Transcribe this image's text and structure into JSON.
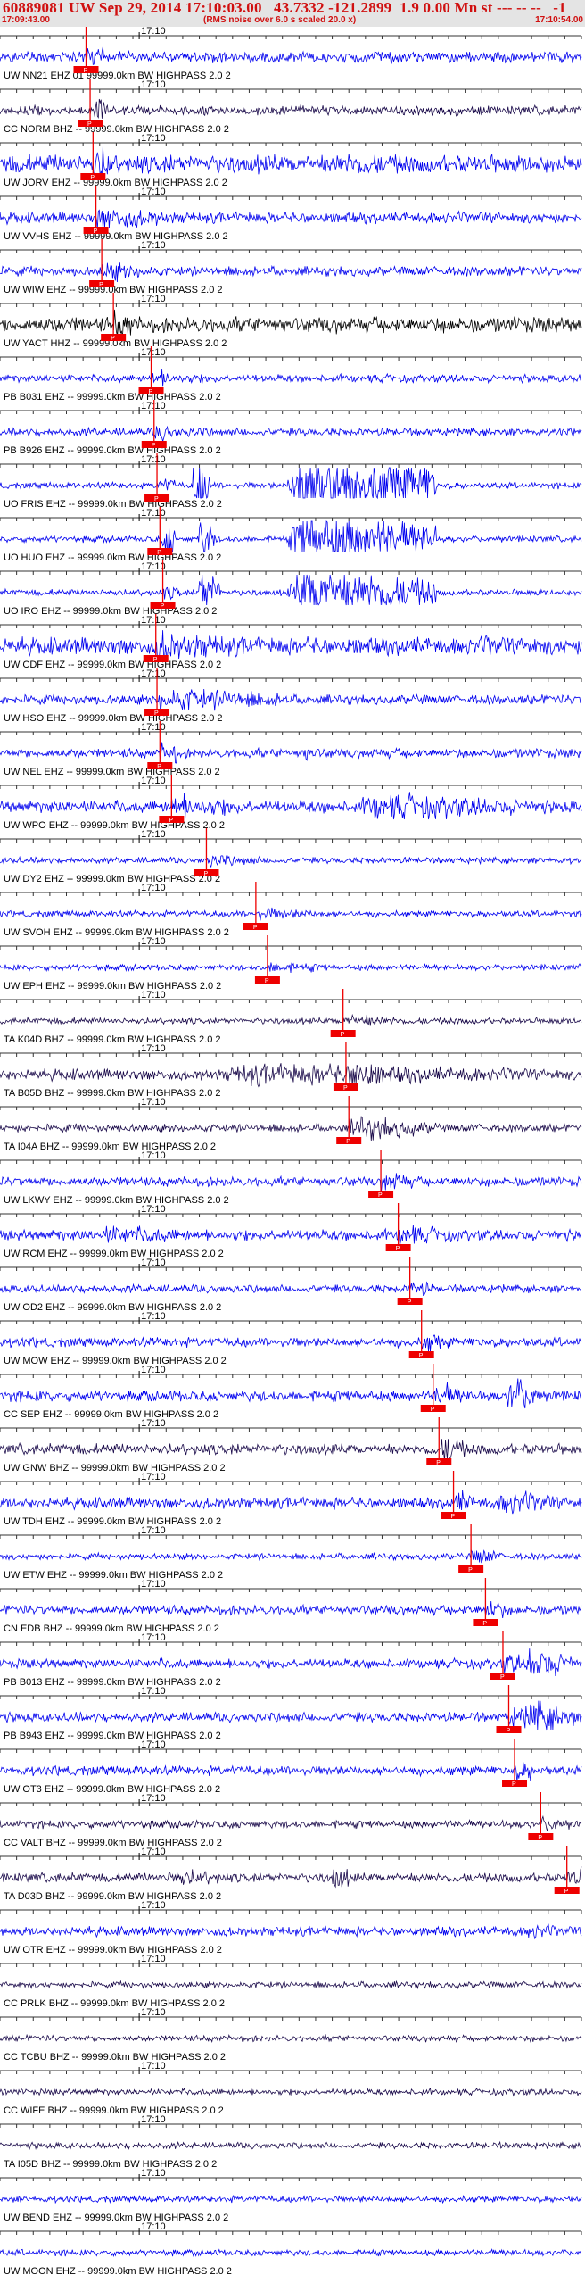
{
  "header": {
    "title": "60889081 UW Sep 29, 2014 17:10:03.00   43.7332 -121.2899  1.9 0.00 Mn st --- -- --   -1",
    "time_start": "17:09:43.00",
    "rms_note": "(RMS noise over 6.0 s scaled 20.0 x)",
    "time_end": "17:10:54.00"
  },
  "chart_data": {
    "type": "line",
    "time_start": "17:09:43.00",
    "time_end": "17:10:54.00",
    "tick_label": "17:10",
    "pick_label": "P",
    "colors": {
      "trace_blue": "#0000ee",
      "trace_dark": "#1a0a4a",
      "trace_black": "#000000",
      "pick": "#ee0000",
      "grid": "#333333"
    },
    "channels": [
      {
        "label": "UW NN21 EHZ 01 99999.0km BW  HIGHPASS  2.0  2",
        "pick": 0.148,
        "color": "blue",
        "amp": 0.35,
        "bursts": [
          [
            0.15,
            0.6,
            0.4
          ]
        ]
      },
      {
        "label": "CC NORM BHZ -- 99999.0km BW  HIGHPASS  2.0  2",
        "pick": 0.155,
        "color": "dark",
        "amp": 0.3,
        "bursts": [
          [
            0.16,
            0.5,
            0.3
          ]
        ]
      },
      {
        "label": "UW JORV EHZ -- 99999.0km BW  HIGHPASS  2.0  2",
        "pick": 0.16,
        "color": "blue",
        "amp": 0.6,
        "bursts": [
          [
            0.16,
            0.4,
            0.6
          ],
          [
            0.55,
            0.8,
            0.9
          ]
        ]
      },
      {
        "label": "UW VVHS EHZ -- 99999.0km BW  HIGHPASS  2.0  2",
        "pick": 0.165,
        "color": "blue",
        "amp": 0.35,
        "bursts": [
          [
            0.165,
            0.3,
            0.9
          ]
        ]
      },
      {
        "label": "UW WIW EHZ -- 99999.0km BW  HIGHPASS  2.0  2",
        "pick": 0.175,
        "color": "blue",
        "amp": 0.3,
        "bursts": [
          [
            0.18,
            0.3,
            0.6
          ]
        ]
      },
      {
        "label": "UW YACT HHZ -- 99999.0km BW  HIGHPASS  2.0  2",
        "pick": 0.195,
        "color": "black",
        "amp": 0.5,
        "bursts": [
          [
            0.2,
            0.4,
            0.5
          ]
        ]
      },
      {
        "label": "PB B031 EHZ -- 99999.0km BW  HIGHPASS  2.0  2",
        "pick": 0.26,
        "color": "blue",
        "amp": 0.25,
        "bursts": [
          [
            0.26,
            0.45,
            0.4
          ]
        ]
      },
      {
        "label": "PB B926 EHZ -- 99999.0km BW  HIGHPASS  2.0  2",
        "pick": 0.265,
        "color": "blue",
        "amp": 0.25,
        "bursts": [
          [
            0.27,
            0.45,
            0.4
          ]
        ]
      },
      {
        "label": "UO FRIS EHZ -- 99999.0km BW  HIGHPASS  2.0  2",
        "pick": 0.27,
        "color": "blue",
        "amp": 0.2,
        "bursts": [
          [
            0.33,
            0.36,
            3.0
          ],
          [
            0.49,
            0.75,
            3.0
          ]
        ]
      },
      {
        "label": "UO HUO EHZ -- 99999.0km BW  HIGHPASS  2.0  2",
        "pick": 0.275,
        "color": "blue",
        "amp": 0.2,
        "bursts": [
          [
            0.28,
            0.3,
            2.0
          ],
          [
            0.34,
            0.37,
            2.0
          ],
          [
            0.49,
            0.75,
            2.2
          ]
        ]
      },
      {
        "label": "UO IRO EHZ -- 99999.0km BW  HIGHPASS  2.0  2",
        "pick": 0.28,
        "color": "blue",
        "amp": 0.2,
        "bursts": [
          [
            0.34,
            0.38,
            2.0
          ],
          [
            0.49,
            0.75,
            2.0
          ]
        ]
      },
      {
        "label": "UW CDF EHZ -- 99999.0km BW  HIGHPASS  2.0  2",
        "pick": 0.268,
        "color": "blue",
        "amp": 0.55,
        "bursts": [
          [
            0.27,
            0.55,
            0.9
          ],
          [
            0.83,
            0.88,
            0.8
          ]
        ]
      },
      {
        "label": "UW HSO EHZ -- 99999.0km BW  HIGHPASS  2.0  2",
        "pick": 0.27,
        "color": "blue",
        "amp": 0.3,
        "bursts": [
          [
            0.27,
            0.5,
            0.9
          ]
        ]
      },
      {
        "label": "UW NEL EHZ -- 99999.0km BW  HIGHPASS  2.0  2",
        "pick": 0.275,
        "color": "blue",
        "amp": 0.3,
        "bursts": [
          [
            0.52,
            0.55,
            0.7
          ]
        ]
      },
      {
        "label": "UW WPO EHZ -- 99999.0km BW  HIGHPASS  2.0  2",
        "pick": 0.295,
        "color": "blue",
        "amp": 0.4,
        "bursts": [
          [
            0.3,
            0.45,
            0.8
          ],
          [
            0.6,
            0.95,
            1.0
          ]
        ]
      },
      {
        "label": "UW DY2 EHZ -- 99999.0km BW  HIGHPASS  2.0  2",
        "pick": 0.355,
        "color": "blue",
        "amp": 0.2,
        "bursts": [
          [
            0.36,
            0.5,
            0.4
          ]
        ]
      },
      {
        "label": "UW SVOH EHZ -- 99999.0km BW  HIGHPASS  2.0  2",
        "pick": 0.44,
        "color": "blue",
        "amp": 0.2,
        "bursts": [
          [
            0.45,
            0.6,
            0.4
          ]
        ]
      },
      {
        "label": "UW EPH EHZ -- 99999.0km BW  HIGHPASS  2.0  2",
        "pick": 0.46,
        "color": "blue",
        "amp": 0.2,
        "bursts": [
          [
            0.46,
            0.6,
            0.4
          ]
        ]
      },
      {
        "label": "TA K04D BHZ -- 99999.0km BW  HIGHPASS  2.0  2",
        "pick": 0.59,
        "color": "dark",
        "amp": 0.2,
        "bursts": [
          [
            0.6,
            0.7,
            0.5
          ]
        ]
      },
      {
        "label": "TA B05D BHZ -- 99999.0km BW  HIGHPASS  2.0  2",
        "pick": 0.595,
        "color": "dark",
        "amp": 0.35,
        "bursts": [
          [
            0.35,
            0.97,
            0.8
          ],
          [
            0.6,
            0.66,
            1.4
          ]
        ]
      },
      {
        "label": "TA I04A BHZ -- 99999.0km BW  HIGHPASS  2.0  2",
        "pick": 0.6,
        "color": "dark",
        "amp": 0.25,
        "bursts": [
          [
            0.6,
            0.75,
            0.9
          ]
        ]
      },
      {
        "label": "UW LKWY EHZ -- 99999.0km BW  HIGHPASS  2.0  2",
        "pick": 0.655,
        "color": "blue",
        "amp": 0.3,
        "bursts": [
          [
            0.65,
            0.72,
            0.8
          ]
        ]
      },
      {
        "label": "UW RCM EHZ -- 99999.0km BW  HIGHPASS  2.0  2",
        "pick": 0.685,
        "color": "blue",
        "amp": 0.35,
        "bursts": [
          [
            0.15,
            0.4,
            0.7
          ],
          [
            0.7,
            0.85,
            0.6
          ]
        ]
      },
      {
        "label": "UW OD2 EHZ -- 99999.0km BW  HIGHPASS  2.0  2",
        "pick": 0.705,
        "color": "blue",
        "amp": 0.25,
        "bursts": [
          [
            0.7,
            0.75,
            0.6
          ]
        ]
      },
      {
        "label": "UW MOW EHZ -- 99999.0km BW  HIGHPASS  2.0  2",
        "pick": 0.725,
        "color": "blue",
        "amp": 0.3,
        "bursts": [
          [
            0.72,
            0.8,
            0.6
          ]
        ]
      },
      {
        "label": "CC SEP EHZ -- 99999.0km BW  HIGHPASS  2.0  2",
        "pick": 0.745,
        "color": "blue",
        "amp": 0.35,
        "bursts": [
          [
            0.76,
            0.8,
            1.0
          ],
          [
            0.87,
            0.93,
            1.6
          ]
        ]
      },
      {
        "label": "UW GNW BHZ -- 99999.0km BW  HIGHPASS  2.0  2",
        "pick": 0.755,
        "color": "dark",
        "amp": 0.35,
        "bursts": [
          [
            0.76,
            0.8,
            1.2
          ]
        ]
      },
      {
        "label": "UW TDH EHZ -- 99999.0km BW  HIGHPASS  2.0  2",
        "pick": 0.78,
        "color": "blue",
        "amp": 0.35,
        "bursts": [
          [
            0.85,
            0.97,
            0.9
          ]
        ]
      },
      {
        "label": "UW ETW EHZ -- 99999.0km BW  HIGHPASS  2.0  2",
        "pick": 0.81,
        "color": "blue",
        "amp": 0.2,
        "bursts": [
          [
            0.81,
            0.86,
            0.7
          ]
        ]
      },
      {
        "label": "CN EDB BHZ -- 99999.0km BW  HIGHPASS  2.0  2",
        "pick": 0.835,
        "color": "blue",
        "amp": 0.3,
        "bursts": [
          [
            0.84,
            0.9,
            0.4
          ]
        ]
      },
      {
        "label": "PB B013 EHZ -- 99999.0km BW  HIGHPASS  2.0  2",
        "pick": 0.865,
        "color": "blue",
        "amp": 0.3,
        "bursts": [
          [
            0.9,
            0.99,
            1.3
          ]
        ]
      },
      {
        "label": "PB B943 EHZ -- 99999.0km BW  HIGHPASS  2.0  2",
        "pick": 0.875,
        "color": "blue",
        "amp": 0.3,
        "bursts": [
          [
            0.9,
            0.99,
            1.3
          ]
        ]
      },
      {
        "label": "UW OT3 EHZ -- 99999.0km BW  HIGHPASS  2.0  2",
        "pick": 0.885,
        "color": "blue",
        "amp": 0.3,
        "bursts": [
          [
            0.89,
            0.95,
            0.5
          ]
        ]
      },
      {
        "label": "CC VALT BHZ -- 99999.0km BW  HIGHPASS  2.0  2",
        "pick": 0.93,
        "color": "dark",
        "amp": 0.25,
        "bursts": [
          [
            0.93,
            0.99,
            0.6
          ]
        ]
      },
      {
        "label": "TA D03D BHZ -- 99999.0km BW  HIGHPASS  2.0  2",
        "pick": 0.975,
        "color": "dark",
        "amp": 0.3,
        "bursts": [
          [
            0.28,
            0.4,
            0.7
          ],
          [
            0.57,
            0.6,
            1.2
          ]
        ]
      },
      {
        "label": "UW OTR EHZ -- 99999.0km BW  HIGHPASS  2.0  2",
        "pick": null,
        "color": "blue",
        "amp": 0.3,
        "bursts": [
          [
            0.9,
            0.98,
            0.6
          ]
        ]
      },
      {
        "label": "CC PRLK BHZ -- 99999.0km BW  HIGHPASS  2.0  2",
        "pick": null,
        "color": "dark",
        "amp": 0.2,
        "bursts": []
      },
      {
        "label": "CC TCBU BHZ -- 99999.0km BW  HIGHPASS  2.0  2",
        "pick": null,
        "color": "dark",
        "amp": 0.2,
        "bursts": []
      },
      {
        "label": "CC WIFE BHZ -- 99999.0km BW  HIGHPASS  2.0  2",
        "pick": null,
        "color": "dark",
        "amp": 0.2,
        "bursts": []
      },
      {
        "label": "TA I05D BHZ -- 99999.0km BW  HIGHPASS  2.0  2",
        "pick": null,
        "color": "dark",
        "amp": 0.2,
        "bursts": []
      },
      {
        "label": "UW BEND EHZ -- 99999.0km BW  HIGHPASS  2.0  2",
        "pick": null,
        "color": "blue",
        "amp": 0.2,
        "bursts": []
      },
      {
        "label": "UW MOON EHZ -- 99999.0km BW  HIGHPASS  2.0  2",
        "pick": null,
        "color": "blue",
        "amp": 0.2,
        "bursts": []
      }
    ]
  }
}
